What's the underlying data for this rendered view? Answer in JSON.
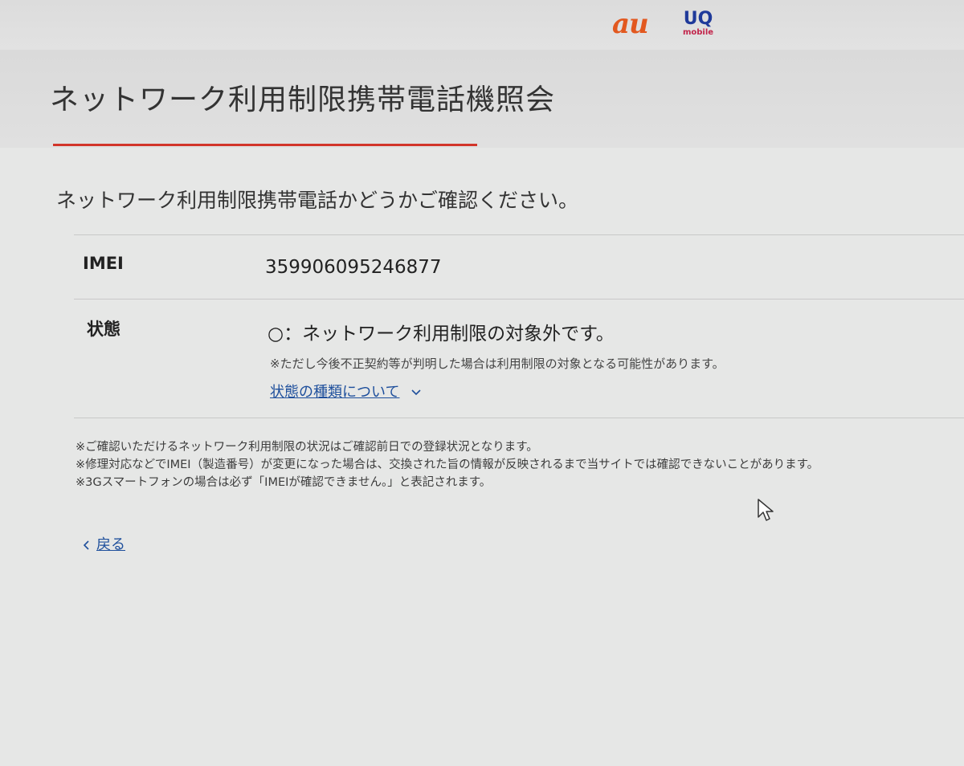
{
  "header": {
    "logo_au": "au",
    "logo_uq": "UQ",
    "logo_uq_sub": "mobile"
  },
  "page": {
    "title": "ネットワーク利用制限携帯電話機照会",
    "intro": "ネットワーク利用制限携帯電話かどうかご確認ください。"
  },
  "result": {
    "imei_label": "IMEI",
    "imei_value": "359906095246877",
    "status_label": "状態",
    "status_value": "○：ネットワーク利用制限の対象外です。",
    "status_note": "※ただし今後不正契約等が判明した場合は利用制限の対象となる可能性があります。",
    "status_link": "状態の種類について"
  },
  "notes": [
    "※ご確認いただけるネットワーク利用制限の状況はご確認前日での登録状況となります。",
    "※修理対応などでIMEI（製造番号）が変更になった場合は、交換された旨の情報が反映されるまで当サイトでは確認できないことがあります。",
    "※3Gスマートフォンの場合は必ず「IMEIが確認できません。」と表記されます。"
  ],
  "nav": {
    "back_label": "戻る"
  },
  "colors": {
    "accent_red": "#d2352a",
    "link_blue": "#1e4f9c",
    "au_orange": "#e2581f",
    "uq_blue": "#1f3a9a"
  }
}
